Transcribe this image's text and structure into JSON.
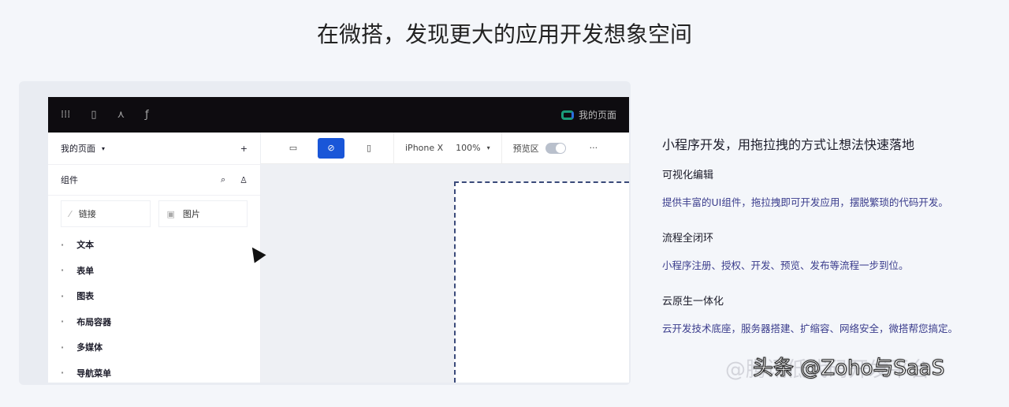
{
  "headline": "在微搭，发现更大的应用开发想象空间",
  "topbar": {
    "app_name": "我的页面"
  },
  "sidebar": {
    "page_select": "我的页面",
    "add": "+",
    "components_label": "组件",
    "chips": [
      {
        "icon": "link-icon",
        "label": "链接"
      },
      {
        "icon": "image-icon",
        "label": "图片"
      }
    ],
    "tree": [
      "文本",
      "表单",
      "图表",
      "布局容器",
      "多媒体",
      "导航菜单"
    ]
  },
  "toolbar": {
    "device": "iPhone X",
    "zoom": "100%",
    "preview_label": "预览区",
    "more": "···"
  },
  "info": {
    "title": "小程序开发，用拖拉拽的方式让想法快速落地",
    "sections": [
      {
        "heading": "可视化编辑",
        "text": "提供丰富的UI组件，拖拉拽即可开发应用，摆脱繁琐的代码开发。"
      },
      {
        "heading": "流程全闭环",
        "text": "小程序注册、授权、开发、预览、发布等流程一步到位。"
      },
      {
        "heading": "云原生一体化",
        "text": "云开发技术底座，服务器搭建、扩缩容、网络安全，微搭帮您搞定。"
      }
    ]
  },
  "watermark": {
    "main": "头条 @Zoho与SaaS",
    "faint": "@腾讯低代码开发平台"
  }
}
